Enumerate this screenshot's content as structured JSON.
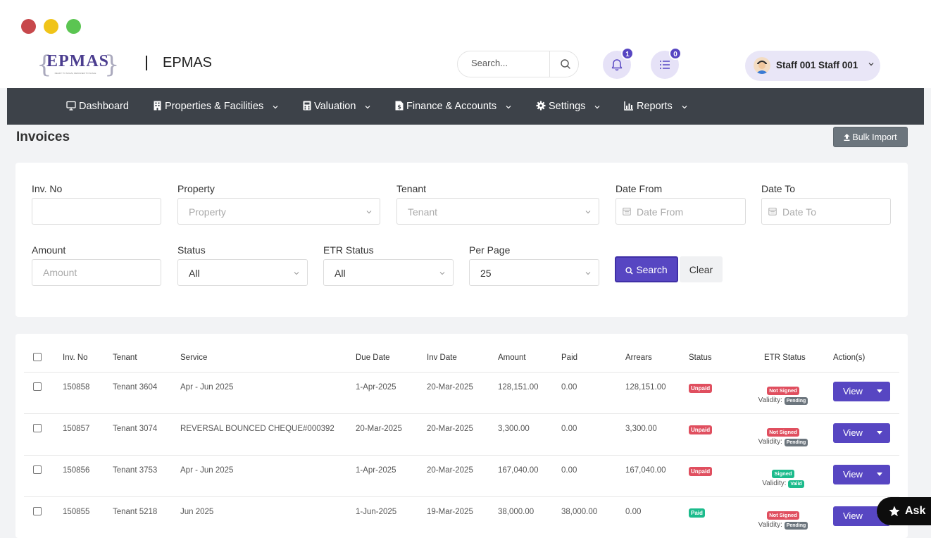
{
  "app": {
    "name": "EPMAS",
    "logo_text": "EPMAS",
    "logo_tagline": "READY TO SOLVE, DESIGNED TO SCALE"
  },
  "header": {
    "search_placeholder": "Search...",
    "notifications_count": "1",
    "tasks_count": "0",
    "user_name": "Staff 001 Staff 001"
  },
  "nav": {
    "dashboard": "Dashboard",
    "properties": "Properties & Facilities",
    "valuation": "Valuation",
    "finance": "Finance & Accounts",
    "settings": "Settings",
    "reports": "Reports"
  },
  "page": {
    "title": "Invoices",
    "bulk_import": "Bulk Import"
  },
  "filters": {
    "inv_no_label": "Inv. No",
    "property_label": "Property",
    "property_placeholder": "Property",
    "tenant_label": "Tenant",
    "tenant_placeholder": "Tenant",
    "date_from_label": "Date From",
    "date_from_placeholder": "Date From",
    "date_to_label": "Date To",
    "date_to_placeholder": "Date To",
    "amount_label": "Amount",
    "amount_placeholder": "Amount",
    "status_label": "Status",
    "status_value": "All",
    "etr_label": "ETR Status",
    "etr_value": "All",
    "per_page_label": "Per Page",
    "per_page_value": "25",
    "search_button": "Search",
    "clear_button": "Clear"
  },
  "table": {
    "headers": {
      "inv_no": "Inv. No",
      "tenant": "Tenant",
      "service": "Service",
      "due_date": "Due Date",
      "inv_date": "Inv Date",
      "amount": "Amount",
      "paid": "Paid",
      "arrears": "Arrears",
      "status": "Status",
      "etr_status": "ETR Status",
      "actions": "Action(s)"
    },
    "validity_label": "Validity:",
    "view_label": "View",
    "rows": [
      {
        "inv_no": "150858",
        "tenant": "Tenant 3604",
        "service": "Apr - Jun 2025",
        "due_date": "1-Apr-2025",
        "inv_date": "20-Mar-2025",
        "amount": "128,151.00",
        "paid": "0.00",
        "arrears": "128,151.00",
        "status": "Unpaid",
        "etr": "Not Signed",
        "validity": "Pending"
      },
      {
        "inv_no": "150857",
        "tenant": "Tenant 3074",
        "service": "REVERSAL BOUNCED CHEQUE#000392",
        "due_date": "20-Mar-2025",
        "inv_date": "20-Mar-2025",
        "amount": "3,300.00",
        "paid": "0.00",
        "arrears": "3,300.00",
        "status": "Unpaid",
        "etr": "Not Signed",
        "validity": "Pending"
      },
      {
        "inv_no": "150856",
        "tenant": "Tenant 3753",
        "service": "Apr - Jun 2025",
        "due_date": "1-Apr-2025",
        "inv_date": "20-Mar-2025",
        "amount": "167,040.00",
        "paid": "0.00",
        "arrears": "167,040.00",
        "status": "Unpaid",
        "etr": "Signed",
        "validity": "Valid"
      },
      {
        "inv_no": "150855",
        "tenant": "Tenant 5218",
        "service": "Jun 2025",
        "due_date": "1-Jun-2025",
        "inv_date": "19-Mar-2025",
        "amount": "38,000.00",
        "paid": "38,000.00",
        "arrears": "0.00",
        "status": "Paid",
        "etr": "Not Signed",
        "validity": "Pending"
      }
    ]
  },
  "ask_button": "Ask",
  "colors": {
    "primary": "#5746c2",
    "navbar": "#3d4249",
    "danger": "#e04f5f",
    "success": "#1cbb8c",
    "secondary": "#6c757d"
  },
  "icons": [
    "search-icon",
    "bell-icon",
    "list-icon",
    "monitor-icon",
    "building-icon",
    "calculator-icon",
    "file-dollar-icon",
    "gear-icon",
    "chart-icon",
    "upload-icon",
    "calendar-icon",
    "star-icon"
  ]
}
